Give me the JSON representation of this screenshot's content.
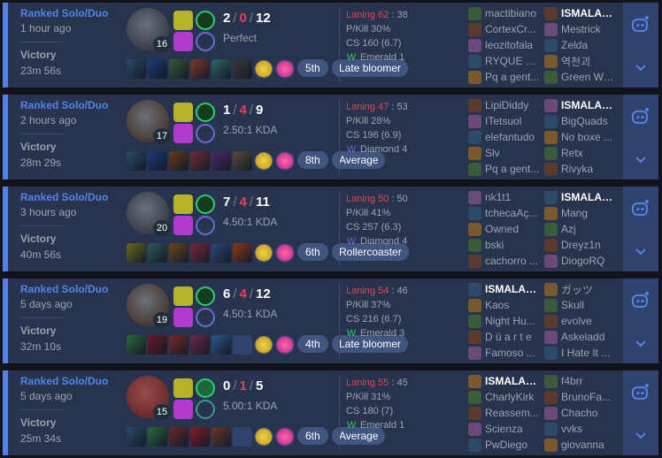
{
  "colors": {
    "accent": "#5383e8",
    "death": "#e84057",
    "text_muted": "#9aa4af",
    "card": "#28344e",
    "win_border": "#5383e8"
  },
  "matches": [
    {
      "queue": "Ranked Solo/Duo",
      "ago": "1 hour ago",
      "result": "Victory",
      "duration": "23m 56s",
      "champ_level": "16",
      "kills": "2",
      "deaths": "0",
      "assists": "12",
      "kda_text": "Perfect",
      "place": "5th",
      "badge": "Late bloomer",
      "lane_label": "Laning 62",
      "lane_value": "38",
      "pkill": "P/Kill 30%",
      "cs": "CS 160 (6.7)",
      "rank": "Emerald 1",
      "blue": [
        "mactibiano",
        "CortexCr...",
        "leozitofala",
        "RYQUE D...",
        "Pq a gent..."
      ],
      "red": [
        "ISMALAK...",
        "Mestrick",
        "Zelda",
        "역천괴",
        "Green Wa..."
      ],
      "me_side": "red",
      "me_index": 0
    },
    {
      "queue": "Ranked Solo/Duo",
      "ago": "2 hours ago",
      "result": "Victory",
      "duration": "28m 29s",
      "champ_level": "17",
      "kills": "1",
      "deaths": "4",
      "assists": "9",
      "kda_text": "2.50:1 KDA",
      "place": "8th",
      "badge": "Average",
      "lane_label": "Laning 47",
      "lane_value": "53",
      "pkill": "P/Kill 28%",
      "cs": "CS 196 (6.9)",
      "rank": "Diamond 4",
      "blue": [
        "LipiDiddy",
        "ITetsuol",
        "elefantudo",
        "Slv",
        "Pq a gent..."
      ],
      "red": [
        "ISMALAK...",
        "BigQuads",
        "No boxe ...",
        "Retx",
        "Rivyka"
      ],
      "me_side": "red",
      "me_index": 0
    },
    {
      "queue": "Ranked Solo/Duo",
      "ago": "3 hours ago",
      "result": "Victory",
      "duration": "40m 56s",
      "champ_level": "20",
      "kills": "7",
      "deaths": "4",
      "assists": "11",
      "kda_text": "4.50:1 KDA",
      "place": "6th",
      "badge": "Rollercoaster",
      "lane_label": "Laning 50",
      "lane_value": "50",
      "pkill": "P/Kill 41%",
      "cs": "CS 257 (6.3)",
      "rank": "Diamond 4",
      "blue": [
        "nk1t1",
        "tchecaAç...",
        "Owned",
        "bski",
        "cachorro ..."
      ],
      "red": [
        "ISMALAK...",
        "Mang",
        "Azj",
        "Dreyz1n",
        "DiogoRQ"
      ],
      "me_side": "red",
      "me_index": 0
    },
    {
      "queue": "Ranked Solo/Duo",
      "ago": "5 days ago",
      "result": "Victory",
      "duration": "32m 10s",
      "champ_level": "19",
      "kills": "6",
      "deaths": "4",
      "assists": "12",
      "kda_text": "4.50:1 KDA",
      "place": "4th",
      "badge": "Late bloomer",
      "lane_label": "Laning 54",
      "lane_value": "46",
      "pkill": "P/Kill 37%",
      "cs": "CS 216 (6.7)",
      "rank": "Emerald 3",
      "blue": [
        "ISMALAK...",
        "Kaos",
        "Night Hu...",
        "D ü a r t e",
        "Famoso ..."
      ],
      "red": [
        "ガッツ",
        "Skull",
        "evolve",
        "Askeladd",
        "I Hate It ..."
      ],
      "me_side": "blue",
      "me_index": 0
    },
    {
      "queue": "Ranked Solo/Duo",
      "ago": "5 days ago",
      "result": "Victory",
      "duration": "25m 34s",
      "champ_level": "15",
      "kills": "0",
      "deaths": "1",
      "assists": "5",
      "kda_text": "5.00:1 KDA",
      "place": "6th",
      "badge": "Average",
      "lane_label": "Laning 55",
      "lane_value": "45",
      "pkill": "P/Kill 31%",
      "cs": "CS 180 (7)",
      "rank": "Emerald 1",
      "blue": [
        "ISMALAK...",
        "CharlyKirk",
        "Reassem...",
        "Scienza",
        "PwDiego"
      ],
      "red": [
        "f4brr",
        "BrunoFa...",
        "Chacho",
        "vvks",
        "giovanna"
      ],
      "me_side": "blue",
      "me_index": 0
    }
  ],
  "icons": {
    "expand": "chevron-down-icon",
    "compare": "robot-face-icon",
    "rank": "wings-icon"
  }
}
